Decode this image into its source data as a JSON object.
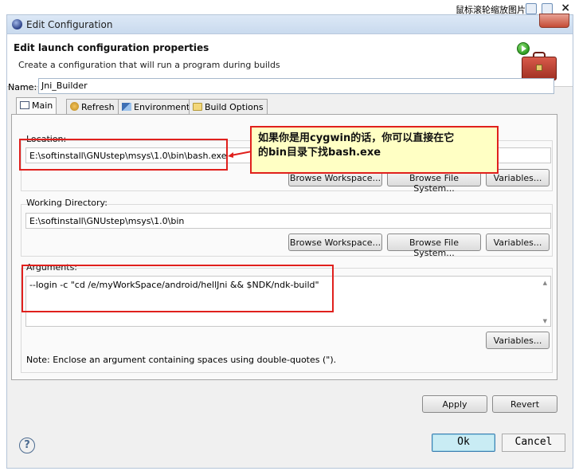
{
  "viewer": {
    "hint": "鼠标滚轮缩放图片",
    "close_glyph": "×"
  },
  "window": {
    "title": "Edit Configuration"
  },
  "header": {
    "title": "Edit launch configuration properties",
    "description": "Create a configuration that will run a program during builds"
  },
  "name": {
    "label": "Name:",
    "value": "Jni_Builder"
  },
  "tabs": [
    {
      "label": "Main",
      "icon": "main-tab-icon"
    },
    {
      "label": "Refresh",
      "icon": "refresh-icon"
    },
    {
      "label": "Environment",
      "icon": "environment-icon"
    },
    {
      "label": "Build Options",
      "icon": "build-options-icon"
    }
  ],
  "location": {
    "label": "Location:",
    "value": "E:\\softinstall\\GNUstep\\msys\\1.0\\bin\\bash.exe",
    "browse_workspace": "Browse Workspace...",
    "browse_file_system": "Browse File System...",
    "variables": "Variables..."
  },
  "working_directory": {
    "label": "Working Directory:",
    "value": "E:\\softinstall\\GNUstep\\msys\\1.0\\bin",
    "browse_workspace": "Browse Workspace...",
    "browse_file_system": "Browse File System...",
    "variables": "Variables..."
  },
  "arguments": {
    "label": "Arguments:",
    "value": "--login -c \"cd /e/myWorkSpace/android/hellJni && $NDK/ndk-build\"",
    "variables": "Variables...",
    "note": "Note: Enclose an argument containing spaces using double-quotes (\")."
  },
  "annotation": {
    "line1": "如果你是用cygwin的话，你可以直接在它",
    "line2": "的bin目录下找bash.exe"
  },
  "actions": {
    "apply": "Apply",
    "revert": "Revert",
    "ok": "Ok",
    "cancel": "Cancel",
    "help_glyph": "?"
  }
}
